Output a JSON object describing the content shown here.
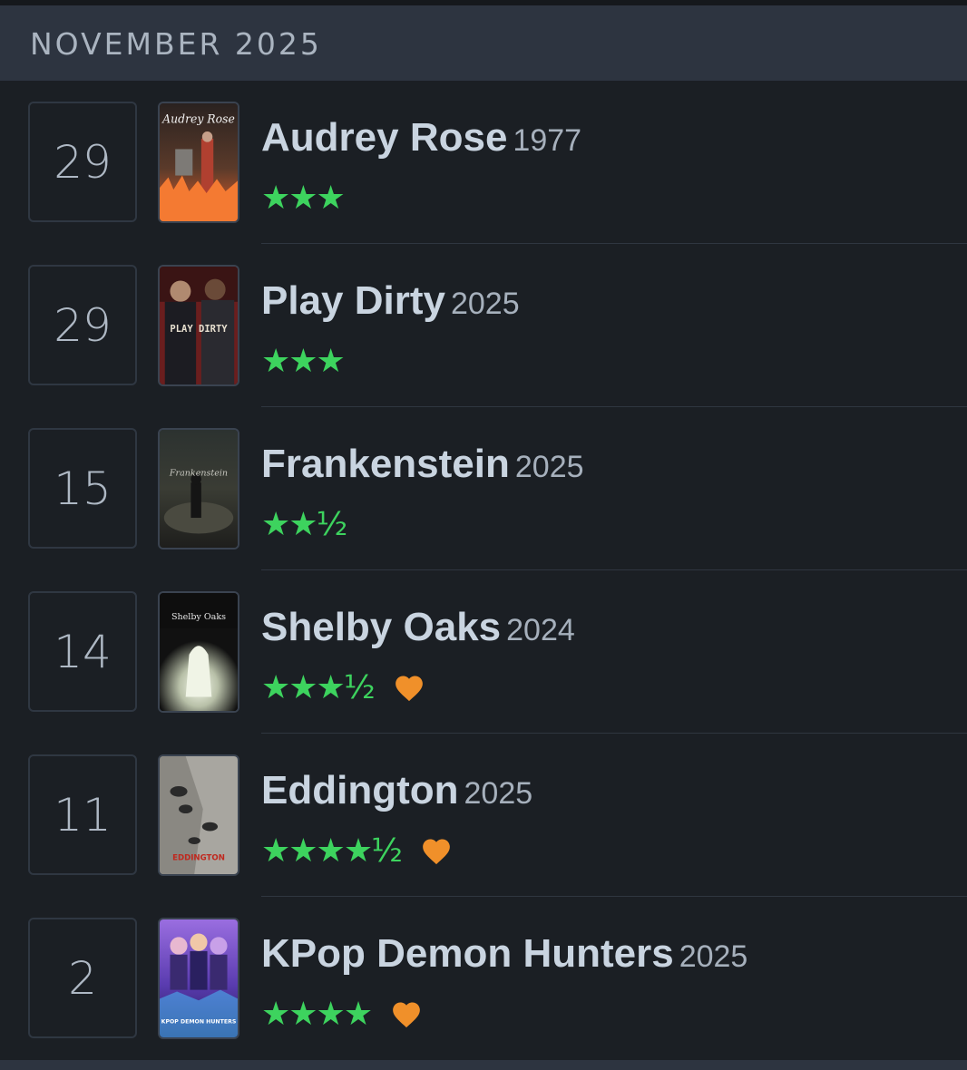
{
  "header": {
    "month_label": "NOVEMBER 2025"
  },
  "colors": {
    "star_green": "#3dd35e",
    "heart_orange": "#f0902a",
    "header_bg": "#2d3440",
    "page_bg": "#1b1f24"
  },
  "entries": [
    {
      "day": "29",
      "title": "Audrey Rose",
      "year": "1977",
      "stars": "★★★",
      "rating": 3,
      "liked": false,
      "poster_text": "Audrey Rose"
    },
    {
      "day": "29",
      "title": "Play Dirty",
      "year": "2025",
      "stars": "★★★",
      "rating": 3,
      "liked": false,
      "poster_text": "PLAY DIRTY"
    },
    {
      "day": "15",
      "title": "Frankenstein",
      "year": "2025",
      "stars": "★★½",
      "rating": 2.5,
      "liked": false,
      "poster_text": "Frankenstein"
    },
    {
      "day": "14",
      "title": "Shelby Oaks",
      "year": "2024",
      "stars": "★★★½",
      "rating": 3.5,
      "liked": true,
      "poster_text": "Shelby Oaks"
    },
    {
      "day": "11",
      "title": "Eddington",
      "year": "2025",
      "stars": "★★★★½",
      "rating": 4.5,
      "liked": true,
      "poster_text": "EDDINGTON"
    },
    {
      "day": "2",
      "title": "KPop Demon Hunters",
      "year": "2025",
      "stars": "★★★★",
      "rating": 4,
      "liked": true,
      "poster_text": "KPOP DEMON HUNTERS"
    }
  ]
}
